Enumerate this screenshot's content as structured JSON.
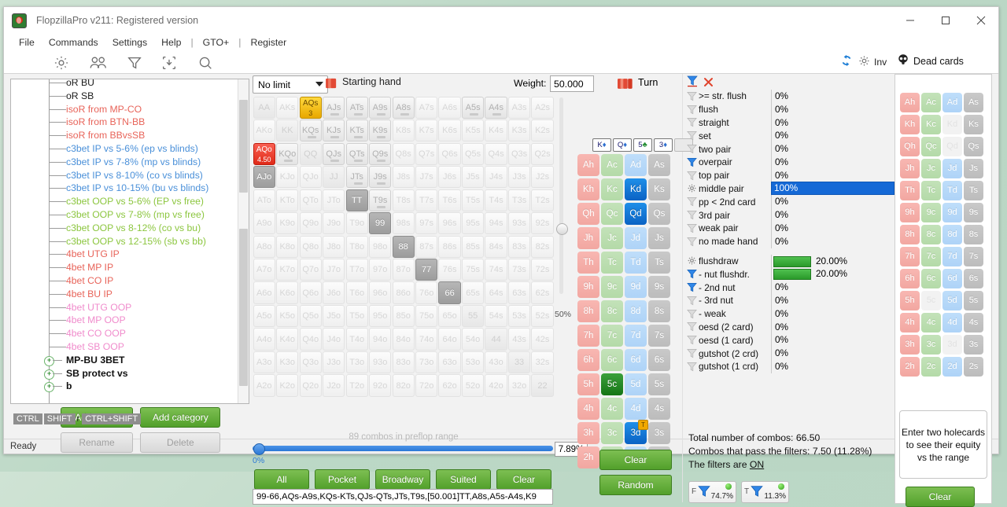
{
  "window": {
    "title": "FlopzillaPro v211: Registered version",
    "minimize": "─",
    "maximize": "☐",
    "close": "✕"
  },
  "menu": [
    "File",
    "Commands",
    "Settings",
    "Help",
    "|",
    "GTO+",
    "|",
    "Register"
  ],
  "toolbar": {
    "icons": [
      "gear-icon",
      "players-icon",
      "filter-icon",
      "import-icon",
      "search-icon"
    ],
    "refresh_icon": "refresh-icon",
    "gear2_icon": "gear-icon",
    "inv_label": "Inv"
  },
  "tree": {
    "items": [
      {
        "label": "oR BU",
        "color": "#1a1a1a",
        "type": "leaf"
      },
      {
        "label": "oR SB",
        "color": "#1a1a1a",
        "type": "leaf"
      },
      {
        "label": "isoR from MP-CO",
        "color": "#e8645a",
        "type": "leaf"
      },
      {
        "label": "isoR from BTN-BB",
        "color": "#e8645a",
        "type": "leaf"
      },
      {
        "label": "isoR from BBvsSB",
        "color": "#e8645a",
        "type": "leaf"
      },
      {
        "label": "c3bet IP vs 5-6% (ep vs blinds)",
        "color": "#4a90d9",
        "type": "leaf"
      },
      {
        "label": "c3bet IP vs 7-8% (mp vs blinds)",
        "color": "#4a90d9",
        "type": "leaf"
      },
      {
        "label": "c3bet IP vs 8-10% (co vs blinds)",
        "color": "#4a90d9",
        "type": "leaf"
      },
      {
        "label": "c3bet IP vs 10-15% (bu vs blinds)",
        "color": "#4a90d9",
        "type": "leaf"
      },
      {
        "label": "c3bet OOP vs 5-6% (EP vs free)",
        "color": "#8cc63f",
        "type": "leaf"
      },
      {
        "label": "c3bet OOP vs 7-8% (mp vs free)",
        "color": "#8cc63f",
        "type": "leaf"
      },
      {
        "label": "c3bet OOP vs 8-12% (co vs bu)",
        "color": "#8cc63f",
        "type": "leaf"
      },
      {
        "label": "c3bet OOP vs 12-15% (sb vs bb)",
        "color": "#8cc63f",
        "type": "leaf"
      },
      {
        "label": "4bet UTG IP",
        "color": "#e8645a",
        "type": "leaf"
      },
      {
        "label": "4bet MP IP",
        "color": "#e8645a",
        "type": "leaf"
      },
      {
        "label": "4bet CO IP",
        "color": "#e8645a",
        "type": "leaf"
      },
      {
        "label": "4bet BU IP",
        "color": "#e8645a",
        "type": "leaf"
      },
      {
        "label": "4bet UTG OOP",
        "color": "#f08ccc",
        "type": "leaf"
      },
      {
        "label": "4bet MP OOP",
        "color": "#f08ccc",
        "type": "leaf"
      },
      {
        "label": "4bet CO OOP",
        "color": "#f08ccc",
        "type": "leaf"
      },
      {
        "label": "4bet SB OOP",
        "color": "#f08ccc",
        "type": "leaf"
      },
      {
        "label": "MP-BU 3BET",
        "color": "#111111",
        "type": "node"
      },
      {
        "label": "SB protect vs",
        "color": "#111111",
        "type": "node"
      },
      {
        "label": "b",
        "color": "#111111",
        "type": "node"
      }
    ],
    "tip": {
      "ctrl": "CTRL",
      "shift": "SHIFT",
      "both": "CTRL+SHIFT"
    },
    "buttons": {
      "add_range": "Add range",
      "add_category": "Add category",
      "rename": "Rename",
      "delete": "Delete"
    }
  },
  "matrix": {
    "game_type": "No limit",
    "starting_hand_label": "Starting hand",
    "weight_label": "Weight:",
    "weight_value": "50.000",
    "combos_text": "89 combos in preflop range",
    "slider_min_label": "0%",
    "slider_value_label": "7.89%",
    "vertical_slider_label": "50%",
    "quick_buttons": [
      "All",
      "Pocket",
      "Broadway",
      "Suited",
      "Clear"
    ],
    "range_text": "99-66,AQs-A9s,KQs-KTs,QJs-QTs,JTs,T9s,[50.001]TT,A8s,A5s-A4s,K9",
    "rows": [
      [
        {
          "t": "AA",
          "s": "pair"
        },
        {
          "t": "AKs",
          "s": "off"
        },
        {
          "t": "AQs",
          "s": "sel-y",
          "sub": "3"
        },
        {
          "t": "AJs",
          "s": "on"
        },
        {
          "t": "ATs",
          "s": "on"
        },
        {
          "t": "A9s",
          "s": "on"
        },
        {
          "t": "A8s",
          "s": "on"
        },
        {
          "t": "A7s",
          "s": "off"
        },
        {
          "t": "A6s",
          "s": "off"
        },
        {
          "t": "A5s",
          "s": "on"
        },
        {
          "t": "A4s",
          "s": "on"
        },
        {
          "t": "A3s",
          "s": "off"
        },
        {
          "t": "A2s",
          "s": "off"
        }
      ],
      [
        {
          "t": "AKo",
          "s": "off"
        },
        {
          "t": "KK",
          "s": "pair"
        },
        {
          "t": "KQs",
          "s": "on"
        },
        {
          "t": "KJs",
          "s": "on"
        },
        {
          "t": "KTs",
          "s": "on"
        },
        {
          "t": "K9s",
          "s": "on"
        },
        {
          "t": "K8s",
          "s": "off"
        },
        {
          "t": "K7s",
          "s": "off"
        },
        {
          "t": "K6s",
          "s": "off"
        },
        {
          "t": "K5s",
          "s": "off"
        },
        {
          "t": "K4s",
          "s": "off"
        },
        {
          "t": "K3s",
          "s": "off"
        },
        {
          "t": "K2s",
          "s": "off"
        }
      ],
      [
        {
          "t": "AQo",
          "s": "sel-r",
          "sub": "4.50"
        },
        {
          "t": "KQo",
          "s": "on"
        },
        {
          "t": "QQ",
          "s": "pair"
        },
        {
          "t": "QJs",
          "s": "on"
        },
        {
          "t": "QTs",
          "s": "on"
        },
        {
          "t": "Q9s",
          "s": "on"
        },
        {
          "t": "Q8s",
          "s": "off"
        },
        {
          "t": "Q7s",
          "s": "off"
        },
        {
          "t": "Q6s",
          "s": "off"
        },
        {
          "t": "Q5s",
          "s": "off"
        },
        {
          "t": "Q4s",
          "s": "off"
        },
        {
          "t": "Q3s",
          "s": "off"
        },
        {
          "t": "Q2s",
          "s": "off"
        }
      ],
      [
        {
          "t": "AJo",
          "s": "grey"
        },
        {
          "t": "KJo",
          "s": "off"
        },
        {
          "t": "QJo",
          "s": "off"
        },
        {
          "t": "JJ",
          "s": "pair"
        },
        {
          "t": "JTs",
          "s": "on"
        },
        {
          "t": "J9s",
          "s": "on"
        },
        {
          "t": "J8s",
          "s": "off"
        },
        {
          "t": "J7s",
          "s": "off"
        },
        {
          "t": "J6s",
          "s": "off"
        },
        {
          "t": "J5s",
          "s": "off"
        },
        {
          "t": "J4s",
          "s": "off"
        },
        {
          "t": "J3s",
          "s": "off"
        },
        {
          "t": "J2s",
          "s": "off"
        }
      ],
      [
        {
          "t": "ATo",
          "s": "off"
        },
        {
          "t": "KTo",
          "s": "off"
        },
        {
          "t": "QTo",
          "s": "off"
        },
        {
          "t": "JTo",
          "s": "off"
        },
        {
          "t": "TT",
          "s": "grey"
        },
        {
          "t": "T9s",
          "s": "on"
        },
        {
          "t": "T8s",
          "s": "off"
        },
        {
          "t": "T7s",
          "s": "off"
        },
        {
          "t": "T6s",
          "s": "off"
        },
        {
          "t": "T5s",
          "s": "off"
        },
        {
          "t": "T4s",
          "s": "off"
        },
        {
          "t": "T3s",
          "s": "off"
        },
        {
          "t": "T2s",
          "s": "off"
        }
      ],
      [
        {
          "t": "A9o",
          "s": "off"
        },
        {
          "t": "K9o",
          "s": "off"
        },
        {
          "t": "Q9o",
          "s": "off"
        },
        {
          "t": "J9o",
          "s": "off"
        },
        {
          "t": "T9o",
          "s": "off"
        },
        {
          "t": "99",
          "s": "grey"
        },
        {
          "t": "98s",
          "s": "off"
        },
        {
          "t": "97s",
          "s": "off"
        },
        {
          "t": "96s",
          "s": "off"
        },
        {
          "t": "95s",
          "s": "off"
        },
        {
          "t": "94s",
          "s": "off"
        },
        {
          "t": "93s",
          "s": "off"
        },
        {
          "t": "92s",
          "s": "off"
        }
      ],
      [
        {
          "t": "A8o",
          "s": "off"
        },
        {
          "t": "K8o",
          "s": "off"
        },
        {
          "t": "Q8o",
          "s": "off"
        },
        {
          "t": "J8o",
          "s": "off"
        },
        {
          "t": "T8o",
          "s": "off"
        },
        {
          "t": "98o",
          "s": "off"
        },
        {
          "t": "88",
          "s": "grey"
        },
        {
          "t": "87s",
          "s": "off"
        },
        {
          "t": "86s",
          "s": "off"
        },
        {
          "t": "85s",
          "s": "off"
        },
        {
          "t": "84s",
          "s": "off"
        },
        {
          "t": "83s",
          "s": "off"
        },
        {
          "t": "82s",
          "s": "off"
        }
      ],
      [
        {
          "t": "A7o",
          "s": "off"
        },
        {
          "t": "K7o",
          "s": "off"
        },
        {
          "t": "Q7o",
          "s": "off"
        },
        {
          "t": "J7o",
          "s": "off"
        },
        {
          "t": "T7o",
          "s": "off"
        },
        {
          "t": "97o",
          "s": "off"
        },
        {
          "t": "87o",
          "s": "off"
        },
        {
          "t": "77",
          "s": "grey"
        },
        {
          "t": "76s",
          "s": "off"
        },
        {
          "t": "75s",
          "s": "off"
        },
        {
          "t": "74s",
          "s": "off"
        },
        {
          "t": "73s",
          "s": "off"
        },
        {
          "t": "72s",
          "s": "off"
        }
      ],
      [
        {
          "t": "A6o",
          "s": "off"
        },
        {
          "t": "K6o",
          "s": "off"
        },
        {
          "t": "Q6o",
          "s": "off"
        },
        {
          "t": "J6o",
          "s": "off"
        },
        {
          "t": "T6o",
          "s": "off"
        },
        {
          "t": "96o",
          "s": "off"
        },
        {
          "t": "86o",
          "s": "off"
        },
        {
          "t": "76o",
          "s": "off"
        },
        {
          "t": "66",
          "s": "grey"
        },
        {
          "t": "65s",
          "s": "off"
        },
        {
          "t": "64s",
          "s": "off"
        },
        {
          "t": "63s",
          "s": "off"
        },
        {
          "t": "62s",
          "s": "off"
        }
      ],
      [
        {
          "t": "A5o",
          "s": "off"
        },
        {
          "t": "K5o",
          "s": "off"
        },
        {
          "t": "Q5o",
          "s": "off"
        },
        {
          "t": "J5o",
          "s": "off"
        },
        {
          "t": "T5o",
          "s": "off"
        },
        {
          "t": "95o",
          "s": "off"
        },
        {
          "t": "85o",
          "s": "off"
        },
        {
          "t": "75o",
          "s": "off"
        },
        {
          "t": "65o",
          "s": "off"
        },
        {
          "t": "55",
          "s": "pair"
        },
        {
          "t": "54s",
          "s": "off"
        },
        {
          "t": "53s",
          "s": "off"
        },
        {
          "t": "52s",
          "s": "off"
        }
      ],
      [
        {
          "t": "A4o",
          "s": "off"
        },
        {
          "t": "K4o",
          "s": "off"
        },
        {
          "t": "Q4o",
          "s": "off"
        },
        {
          "t": "J4o",
          "s": "off"
        },
        {
          "t": "T4o",
          "s": "off"
        },
        {
          "t": "94o",
          "s": "off"
        },
        {
          "t": "84o",
          "s": "off"
        },
        {
          "t": "74o",
          "s": "off"
        },
        {
          "t": "64o",
          "s": "off"
        },
        {
          "t": "54o",
          "s": "off"
        },
        {
          "t": "44",
          "s": "pair"
        },
        {
          "t": "43s",
          "s": "off"
        },
        {
          "t": "42s",
          "s": "off"
        }
      ],
      [
        {
          "t": "A3o",
          "s": "off"
        },
        {
          "t": "K3o",
          "s": "off"
        },
        {
          "t": "Q3o",
          "s": "off"
        },
        {
          "t": "J3o",
          "s": "off"
        },
        {
          "t": "T3o",
          "s": "off"
        },
        {
          "t": "93o",
          "s": "off"
        },
        {
          "t": "83o",
          "s": "off"
        },
        {
          "t": "73o",
          "s": "off"
        },
        {
          "t": "63o",
          "s": "off"
        },
        {
          "t": "53o",
          "s": "off"
        },
        {
          "t": "43o",
          "s": "off"
        },
        {
          "t": "33",
          "s": "pair"
        },
        {
          "t": "32s",
          "s": "off"
        }
      ],
      [
        {
          "t": "A2o",
          "s": "off"
        },
        {
          "t": "K2o",
          "s": "off"
        },
        {
          "t": "Q2o",
          "s": "off"
        },
        {
          "t": "J2o",
          "s": "off"
        },
        {
          "t": "T2o",
          "s": "off"
        },
        {
          "t": "92o",
          "s": "off"
        },
        {
          "t": "82o",
          "s": "off"
        },
        {
          "t": "72o",
          "s": "off"
        },
        {
          "t": "62o",
          "s": "off"
        },
        {
          "t": "52o",
          "s": "off"
        },
        {
          "t": "42o",
          "s": "off"
        },
        {
          "t": "32o",
          "s": "off"
        },
        {
          "t": "22",
          "s": "pair"
        }
      ]
    ]
  },
  "board": {
    "street_label": "Turn",
    "slots": [
      {
        "rank": "K",
        "suit": "♦",
        "suit_class": "s-d"
      },
      {
        "rank": "Q",
        "suit": "♦",
        "suit_class": "s-d"
      },
      {
        "rank": "5",
        "suit": "♣",
        "suit_class": "s-c"
      },
      {
        "rank": "3",
        "suit": "♦",
        "suit_class": "s-d"
      },
      {
        "rank": "",
        "suit": "",
        "suit_class": "empty"
      }
    ],
    "clear_button": "Clear",
    "random_button": "Random",
    "ranks": [
      "A",
      "K",
      "Q",
      "J",
      "T",
      "9",
      "8",
      "7",
      "6",
      "5",
      "4",
      "3",
      "2"
    ],
    "suits": [
      "h",
      "c",
      "d",
      "s"
    ],
    "selected": {
      "Kd": "blue",
      "Qd": "blue",
      "5c": "green",
      "3d": "blue-turn"
    },
    "turn_badge": "T"
  },
  "filters": {
    "made_hands": [
      {
        "name": ">= str. flush",
        "value": "0%",
        "icon": "funnel-grey"
      },
      {
        "name": "flush",
        "value": "0%",
        "icon": "funnel-grey"
      },
      {
        "name": "straight",
        "value": "0%",
        "icon": "funnel-grey"
      },
      {
        "name": "set",
        "value": "0%",
        "icon": "funnel-grey"
      },
      {
        "name": "two pair",
        "value": "0%",
        "icon": "funnel-grey"
      },
      {
        "name": "overpair",
        "value": "0%",
        "icon": "funnel-blue"
      },
      {
        "name": "top pair",
        "value": "0%",
        "icon": "funnel-grey"
      },
      {
        "name": "middle pair",
        "value": "100%",
        "icon": "gear-icon",
        "highlight": true
      },
      {
        "name": "pp < 2nd card",
        "value": "0%",
        "icon": "funnel-grey"
      },
      {
        "name": "3rd pair",
        "value": "0%",
        "icon": "funnel-grey"
      },
      {
        "name": "weak pair",
        "value": "0%",
        "icon": "funnel-grey"
      },
      {
        "name": "no made hand",
        "value": "0%",
        "icon": "funnel-grey"
      }
    ],
    "draws": [
      {
        "name": "flushdraw",
        "value": "20.00%",
        "icon": "gear-icon",
        "bar": true
      },
      {
        "name": "- nut flushdr.",
        "value": "20.00%",
        "icon": "funnel-blue",
        "bar": true
      },
      {
        "name": "- 2nd nut",
        "value": "0%",
        "icon": "funnel-blue"
      },
      {
        "name": "- 3rd nut",
        "value": "0%",
        "icon": "funnel-grey"
      },
      {
        "name": "- weak",
        "value": "0%",
        "icon": "funnel-grey"
      },
      {
        "name": "oesd (2 card)",
        "value": "0%",
        "icon": "funnel-grey"
      },
      {
        "name": "oesd (1 card)",
        "value": "0%",
        "icon": "funnel-grey"
      },
      {
        "name": "gutshot (2 crd)",
        "value": "0%",
        "icon": "funnel-grey"
      },
      {
        "name": "gutshot (1 crd)",
        "value": "0%",
        "icon": "funnel-grey"
      }
    ],
    "summary": {
      "total": "Total number of combos: 66.50",
      "pass": "Combos that pass the filters: 7.50 (11.28%)",
      "state_prefix": "The filters are ",
      "state": "ON"
    },
    "badges": [
      {
        "prefix": "F",
        "value": "74.7%"
      },
      {
        "prefix": "T",
        "value": "11.3%"
      }
    ]
  },
  "dead_cards": {
    "title": "Dead cards",
    "ranks": [
      "A",
      "K",
      "Q",
      "J",
      "T",
      "9",
      "8",
      "7",
      "6",
      "5",
      "4",
      "3",
      "2"
    ],
    "suits": [
      "h",
      "c",
      "d",
      "s"
    ],
    "disabled": [
      "Kd",
      "Qd",
      "5c",
      "3d"
    ],
    "equity_note": "Enter two holecards to see their equity vs the range",
    "clear_button": "Clear"
  },
  "status": {
    "text": "Ready"
  },
  "colors": {
    "accent_blue": "#1569d6",
    "green_button": "#52a02b",
    "selected_yellow": "#e8a800",
    "selected_red": "#e02a18"
  }
}
